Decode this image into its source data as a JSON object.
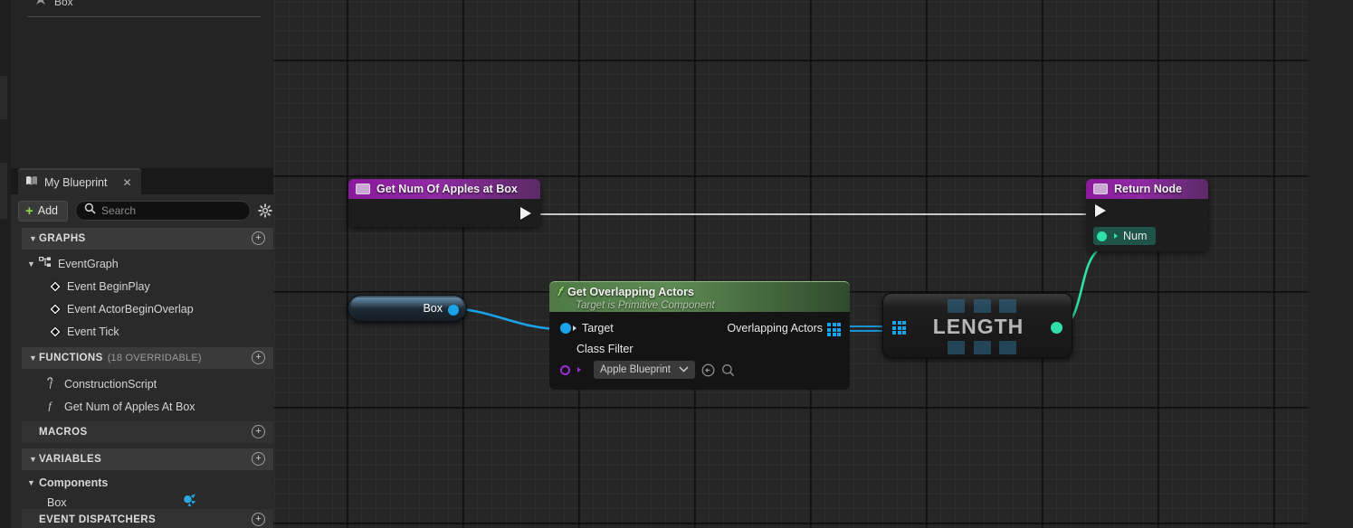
{
  "app": {
    "editor": "Unreal Engine Blueprint Editor"
  },
  "sidebar": {
    "top_stub_item": {
      "label": "Box",
      "icon": "component-icon"
    },
    "panel": {
      "tab_label": "My Blueprint",
      "tab_icon": "book-icon",
      "close_icon": "close-icon"
    },
    "toolbar": {
      "add_label": "Add",
      "add_icon": "plus-icon",
      "search_placeholder": "Search",
      "search_value": "",
      "search_icon": "search-icon",
      "settings_icon": "gear-icon"
    },
    "sections": [
      {
        "id": "graphs",
        "title": "GRAPHS",
        "subtitle": "",
        "collapsed": false,
        "add_icon": "plus-circle-icon",
        "items": [
          {
            "label": "EventGraph",
            "icon": "graph-icon",
            "depth": 0,
            "caret": "▼"
          },
          {
            "label": "Event BeginPlay",
            "icon": "event-diamond-icon",
            "depth": 1
          },
          {
            "label": "Event ActorBeginOverlap",
            "icon": "event-diamond-icon",
            "depth": 1
          },
          {
            "label": "Event Tick",
            "icon": "event-diamond-icon",
            "depth": 1
          }
        ]
      },
      {
        "id": "functions",
        "title": "FUNCTIONS",
        "subtitle": "(18 OVERRIDABLE)",
        "collapsed": false,
        "add_icon": "plus-circle-icon",
        "items": [
          {
            "label": "ConstructionScript",
            "icon": "construction-function-icon",
            "depth": 1
          },
          {
            "label": "Get Num of Apples At Box",
            "icon": "function-icon",
            "depth": 1
          }
        ]
      },
      {
        "id": "macros",
        "title": "MACROS",
        "subtitle": "",
        "collapsed": true,
        "add_icon": "plus-circle-icon",
        "items": []
      },
      {
        "id": "variables",
        "title": "VARIABLES",
        "subtitle": "",
        "collapsed": false,
        "add_icon": "plus-circle-icon",
        "items": []
      },
      {
        "id": "event-dispatchers",
        "title": "EVENT DISPATCHERS",
        "subtitle": "",
        "collapsed": true,
        "add_icon": "plus-circle-icon",
        "items": []
      }
    ],
    "components_group": {
      "label": "Components",
      "caret": "▼"
    },
    "components_items": [
      {
        "label": "Box",
        "icon": "box-component-icon"
      }
    ]
  },
  "graph": {
    "nodes": {
      "entry": {
        "title": "Get Num Of Apples at Box",
        "icon": "function-entry-icon",
        "exec_out_icon": "exec-pin-icon"
      },
      "return": {
        "title": "Return Node",
        "icon": "function-result-icon",
        "exec_in_icon": "exec-pin-icon",
        "pins": [
          {
            "label": "Num",
            "type": "integer",
            "color": "#2fe0a8"
          }
        ]
      },
      "box_getter": {
        "label": "Box",
        "pin_type": "object-reference",
        "pin_color": "#1aa3e8"
      },
      "get_overlapping_actors": {
        "title": "Get Overlapping Actors",
        "subtitle": "Target is Primitive Component",
        "icon": "function-f-icon",
        "inputs": [
          {
            "label": "Target",
            "type": "object",
            "color": "#1aa3e8"
          },
          {
            "label": "Class Filter",
            "type": "class",
            "color": "#9b2fd6"
          }
        ],
        "outputs": [
          {
            "label": "Overlapping Actors",
            "type": "array-of-actor",
            "color": "#1aa3e8"
          }
        ],
        "class_filter": {
          "value": "Apple Blueprint",
          "dropdown_icon": "chevron-down-icon",
          "browse_icon": "browse-back-icon",
          "search_icon": "magnifier-icon"
        }
      },
      "length": {
        "title": "LENGTH",
        "input_type": "array",
        "output_type": "integer",
        "input_color": "#1aa3e8",
        "output_color": "#2fe0a8"
      }
    },
    "wires": [
      {
        "from": "entry.exec",
        "to": "return.exec",
        "color": "#ffffff",
        "kind": "exec"
      },
      {
        "from": "box_getter.out",
        "to": "get_overlapping_actors.target",
        "color": "#1aa3e8",
        "kind": "data"
      },
      {
        "from": "get_overlapping_actors.overlapping_actors",
        "to": "length.in",
        "color": "#1aa3e8",
        "kind": "array"
      },
      {
        "from": "length.out",
        "to": "return.num",
        "color": "#2fe0a8",
        "kind": "data"
      }
    ]
  },
  "colors": {
    "canvas_bg": "#262626",
    "panel_bg": "#2a2a2a",
    "section_bg": "#3a3a3a",
    "accent_green": "#8ddb4f",
    "exec_white": "#ffffff",
    "object_blue": "#1aa3e8",
    "int_green": "#2fe0a8",
    "class_purple": "#9b2fd6",
    "entry_purple": "#8a1a9c"
  }
}
